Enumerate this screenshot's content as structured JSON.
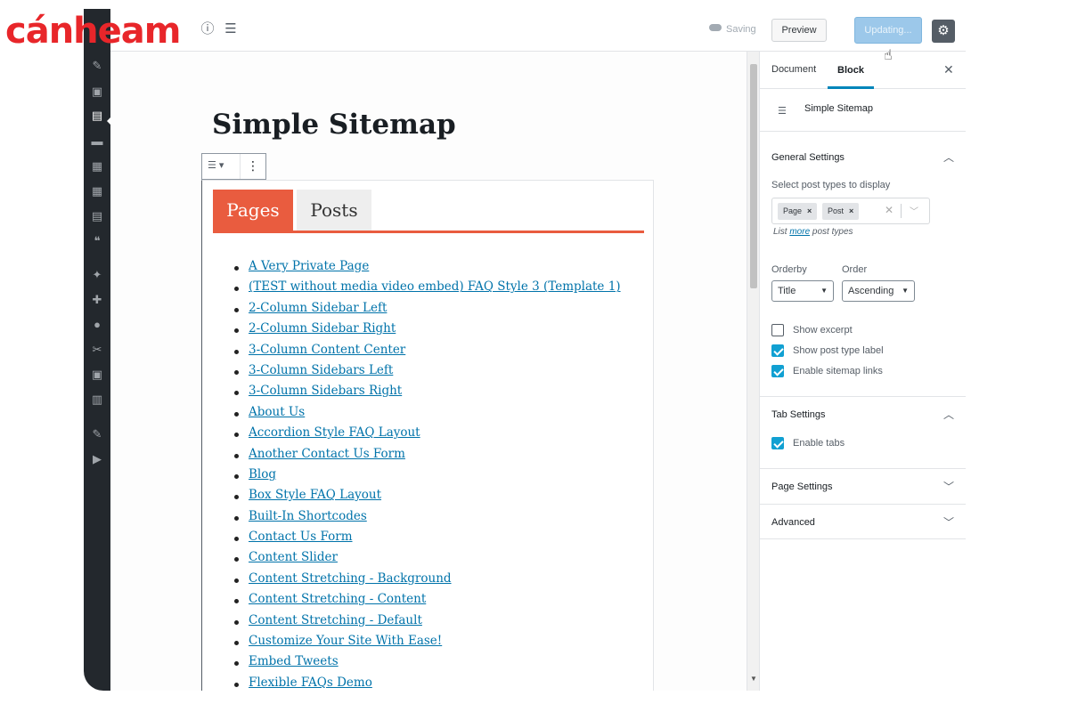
{
  "watermark": {
    "text": "cánheam"
  },
  "toolbar": {
    "saving": "Saving",
    "preview": "Preview",
    "updating": "Updating..."
  },
  "editor": {
    "title": "Simple Sitemap",
    "tabs": [
      "Pages",
      "Posts"
    ],
    "pages": [
      " A Very Private Page",
      "(TEST without media video embed) FAQ Style 3 (Template 1)",
      "2-Column Sidebar Left",
      "2-Column Sidebar Right",
      "3-Column Content Center",
      "3-Column Sidebars Left",
      "3-Column Sidebars Right",
      "About Us",
      "Accordion Style FAQ Layout",
      "Another Contact Us Form",
      "Blog",
      "Box Style FAQ Layout",
      "Built-In Shortcodes",
      "Contact Us Form",
      "Content Slider",
      "Content Stretching - Background",
      "Content Stretching - Content",
      "Content Stretching - Default",
      "Customize Your Site With Ease!",
      "Embed Tweets",
      "Flexible FAQs Demo"
    ]
  },
  "sidebar": {
    "tabs": {
      "document": "Document",
      "block": "Block"
    },
    "block_name": "Simple Sitemap",
    "general": {
      "title": "General Settings",
      "post_types_label": "Select post types to display",
      "tokens": [
        "Page",
        "Post"
      ],
      "help_prefix": "List ",
      "help_link": "more",
      "help_suffix": " post types",
      "orderby_label": "Orderby",
      "orderby_value": "Title",
      "order_label": "Order",
      "order_value": "Ascending",
      "checkboxes": [
        {
          "label": "Show excerpt",
          "checked": false
        },
        {
          "label": "Show post type label",
          "checked": true
        },
        {
          "label": "Enable sitemap links",
          "checked": true
        }
      ]
    },
    "tab_settings": {
      "title": "Tab Settings",
      "enable_tabs": "Enable tabs",
      "enable_tabs_checked": true
    },
    "page_settings": "Page Settings",
    "advanced": "Advanced"
  },
  "colors": {
    "tab_active": "#e95c3f",
    "link": "#0073aa",
    "admin_bar": "#23282d",
    "checkbox": "#11a0d2",
    "update_button": "#9cc8ea"
  }
}
